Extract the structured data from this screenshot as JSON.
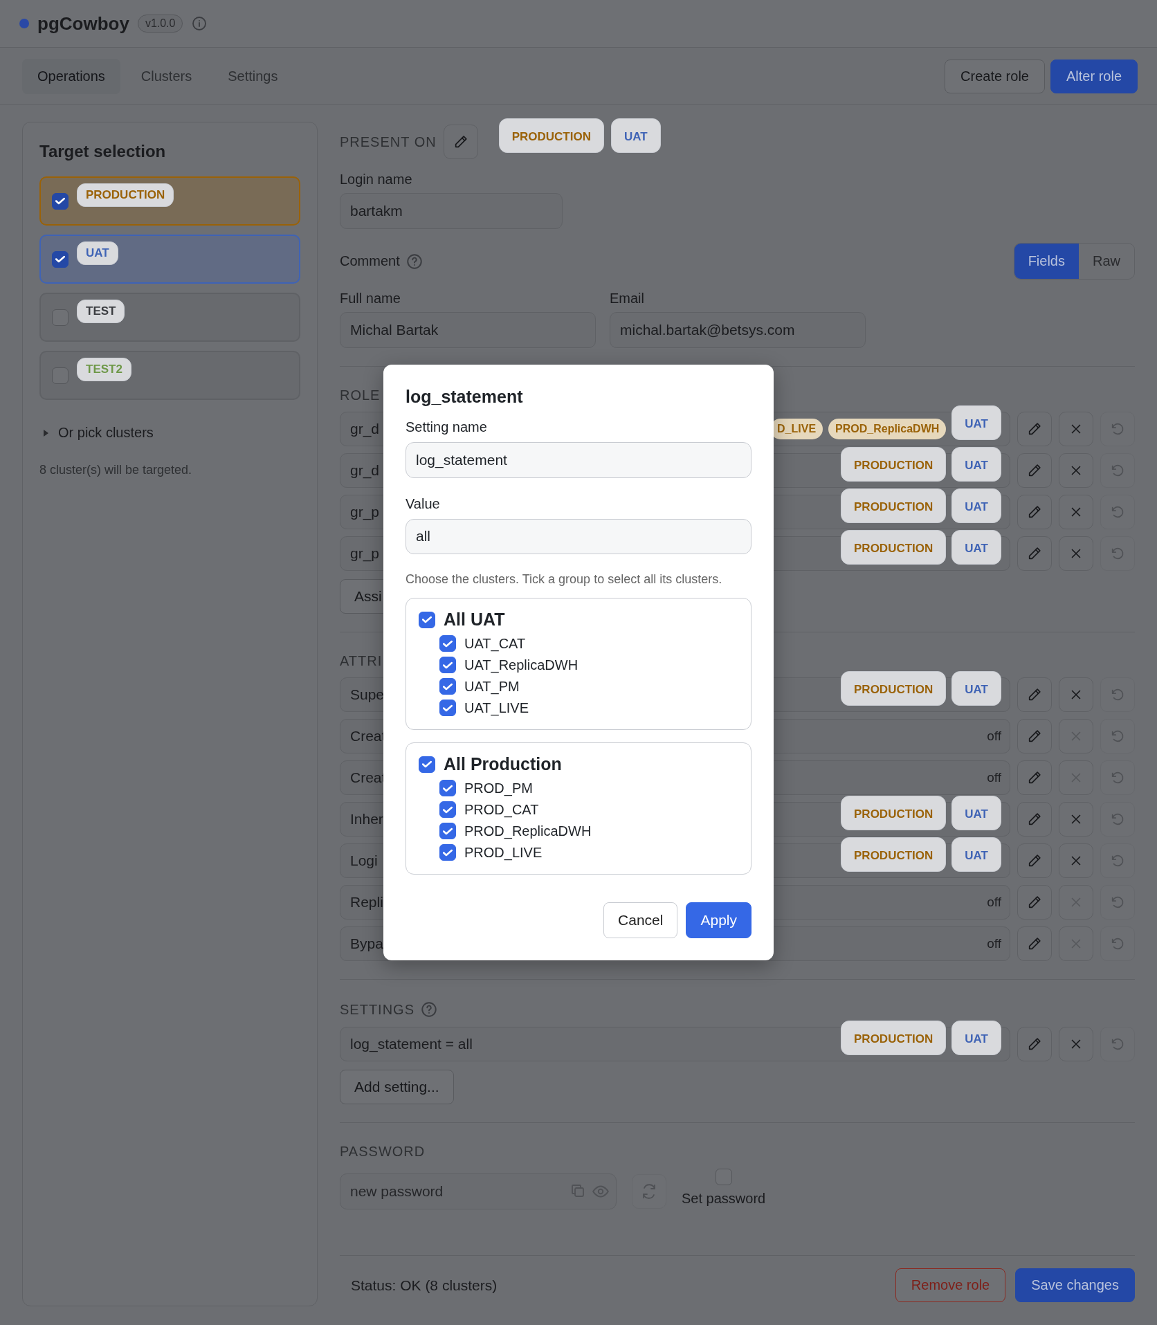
{
  "app": {
    "title": "pgCowboy",
    "version": "v1.0.0"
  },
  "tabs": [
    {
      "label": "Operations",
      "selected": true
    },
    {
      "label": "Clusters",
      "selected": false
    },
    {
      "label": "Settings",
      "selected": false
    }
  ],
  "actions": [
    {
      "label": "Create role",
      "kind": "secondary"
    },
    {
      "label": "Alter role",
      "kind": "primary"
    }
  ],
  "sidebar": {
    "title": "Target selection",
    "targets": [
      {
        "label": "PRODUCTION",
        "checked": true,
        "color": "#9a6208"
      },
      {
        "label": "UAT",
        "checked": true,
        "color": "#3f63b5"
      },
      {
        "label": "TEST",
        "checked": false,
        "color": "#3a3c40"
      },
      {
        "label": "TEST2",
        "checked": false,
        "color": "#6e9848"
      }
    ],
    "pick_clusters": "Or pick clusters",
    "summary": "8 cluster(s) will be targeted."
  },
  "present_on": {
    "label": "PRESENT ON",
    "badges": [
      {
        "label": "PRODUCTION",
        "kind": "group",
        "color": "#9a6208"
      },
      {
        "label": "UAT",
        "kind": "group",
        "color": "#3f63b5"
      }
    ]
  },
  "login": {
    "label": "Login name",
    "value": "bartakm"
  },
  "comment": {
    "label": "Comment",
    "modes": [
      {
        "label": "Fields",
        "selected": true
      },
      {
        "label": "Raw",
        "selected": false
      }
    ]
  },
  "full_name": {
    "label": "Full name",
    "value": "Michal Bartak"
  },
  "email": {
    "label": "Email",
    "value": "michal.bartak@betsys.com"
  },
  "roles": {
    "title": "ROLE",
    "rows": [
      {
        "name": "gr_d",
        "removable": true,
        "badges": [
          {
            "label": "D_LIVE",
            "kind": "cluster",
            "color": "#9a6208"
          },
          {
            "label": "PROD_ReplicaDWH",
            "kind": "cluster",
            "color": "#9a6208"
          },
          {
            "label": "UAT",
            "kind": "group",
            "color": "#3f63b5"
          }
        ]
      },
      {
        "name": "gr_d",
        "removable": true,
        "badges": [
          {
            "label": "PRODUCTION",
            "kind": "group",
            "color": "#9a6208"
          },
          {
            "label": "UAT",
            "kind": "group",
            "color": "#3f63b5"
          }
        ]
      },
      {
        "name": "gr_p",
        "removable": true,
        "badges": [
          {
            "label": "PRODUCTION",
            "kind": "group",
            "color": "#9a6208"
          },
          {
            "label": "UAT",
            "kind": "group",
            "color": "#3f63b5"
          }
        ]
      },
      {
        "name": "gr_p",
        "removable": true,
        "badges": [
          {
            "label": "PRODUCTION",
            "kind": "group",
            "color": "#9a6208"
          },
          {
            "label": "UAT",
            "kind": "group",
            "color": "#3f63b5"
          }
        ]
      }
    ],
    "add_button": "Assi"
  },
  "attributes": {
    "title": "ATTRI",
    "rows": [
      {
        "name": "Supe",
        "removable": true,
        "badges": [
          {
            "label": "PRODUCTION",
            "kind": "group",
            "color": "#9a6208"
          },
          {
            "label": "UAT",
            "kind": "group",
            "color": "#3f63b5"
          }
        ]
      },
      {
        "name": "Creat",
        "removable": false,
        "value": "off"
      },
      {
        "name": "Creat",
        "removable": false,
        "value": "off"
      },
      {
        "name": "Inher",
        "removable": true,
        "badges": [
          {
            "label": "PRODUCTION",
            "kind": "group",
            "color": "#9a6208"
          },
          {
            "label": "UAT",
            "kind": "group",
            "color": "#3f63b5"
          }
        ]
      },
      {
        "name": "Logi",
        "removable": true,
        "badges": [
          {
            "label": "PRODUCTION",
            "kind": "group",
            "color": "#9a6208"
          },
          {
            "label": "UAT",
            "kind": "group",
            "color": "#3f63b5"
          }
        ]
      },
      {
        "name": "Repli",
        "removable": false,
        "value": "off"
      },
      {
        "name": "Bypa",
        "removable": false,
        "value": "off"
      }
    ]
  },
  "settings": {
    "title": "SETTINGS",
    "rows": [
      {
        "name": "log_statement = all",
        "removable": true,
        "badges": [
          {
            "label": "PRODUCTION",
            "kind": "group",
            "color": "#9a6208"
          },
          {
            "label": "UAT",
            "kind": "group",
            "color": "#3f63b5"
          }
        ]
      }
    ],
    "add_button": "Add setting..."
  },
  "password": {
    "title": "PASSWORD",
    "placeholder": "new password",
    "set_label": "Set password",
    "set_checked": false
  },
  "status": "Status: OK (8 clusters)",
  "footer_buttons": [
    {
      "label": "Remove role",
      "kind": "danger"
    },
    {
      "label": "Save changes",
      "kind": "primary"
    }
  ],
  "dialog": {
    "title": "log_statement",
    "fields": [
      {
        "label": "Setting name",
        "value": "log_statement"
      },
      {
        "label": "Value",
        "value": "all"
      }
    ],
    "hint": "Choose the clusters. Tick a group to select all its clusters.",
    "groups": [
      {
        "label": "All UAT",
        "checked": true,
        "items": [
          {
            "label": "UAT_CAT",
            "checked": true
          },
          {
            "label": "UAT_ReplicaDWH",
            "checked": true
          },
          {
            "label": "UAT_PM",
            "checked": true
          },
          {
            "label": "UAT_LIVE",
            "checked": true
          }
        ]
      },
      {
        "label": "All Production",
        "checked": true,
        "items": [
          {
            "label": "PROD_PM",
            "checked": true
          },
          {
            "label": "PROD_CAT",
            "checked": true
          },
          {
            "label": "PROD_ReplicaDWH",
            "checked": true
          },
          {
            "label": "PROD_LIVE",
            "checked": true
          }
        ]
      }
    ],
    "buttons": [
      {
        "label": "Cancel",
        "kind": "secondary"
      },
      {
        "label": "Apply",
        "kind": "primary"
      }
    ]
  }
}
